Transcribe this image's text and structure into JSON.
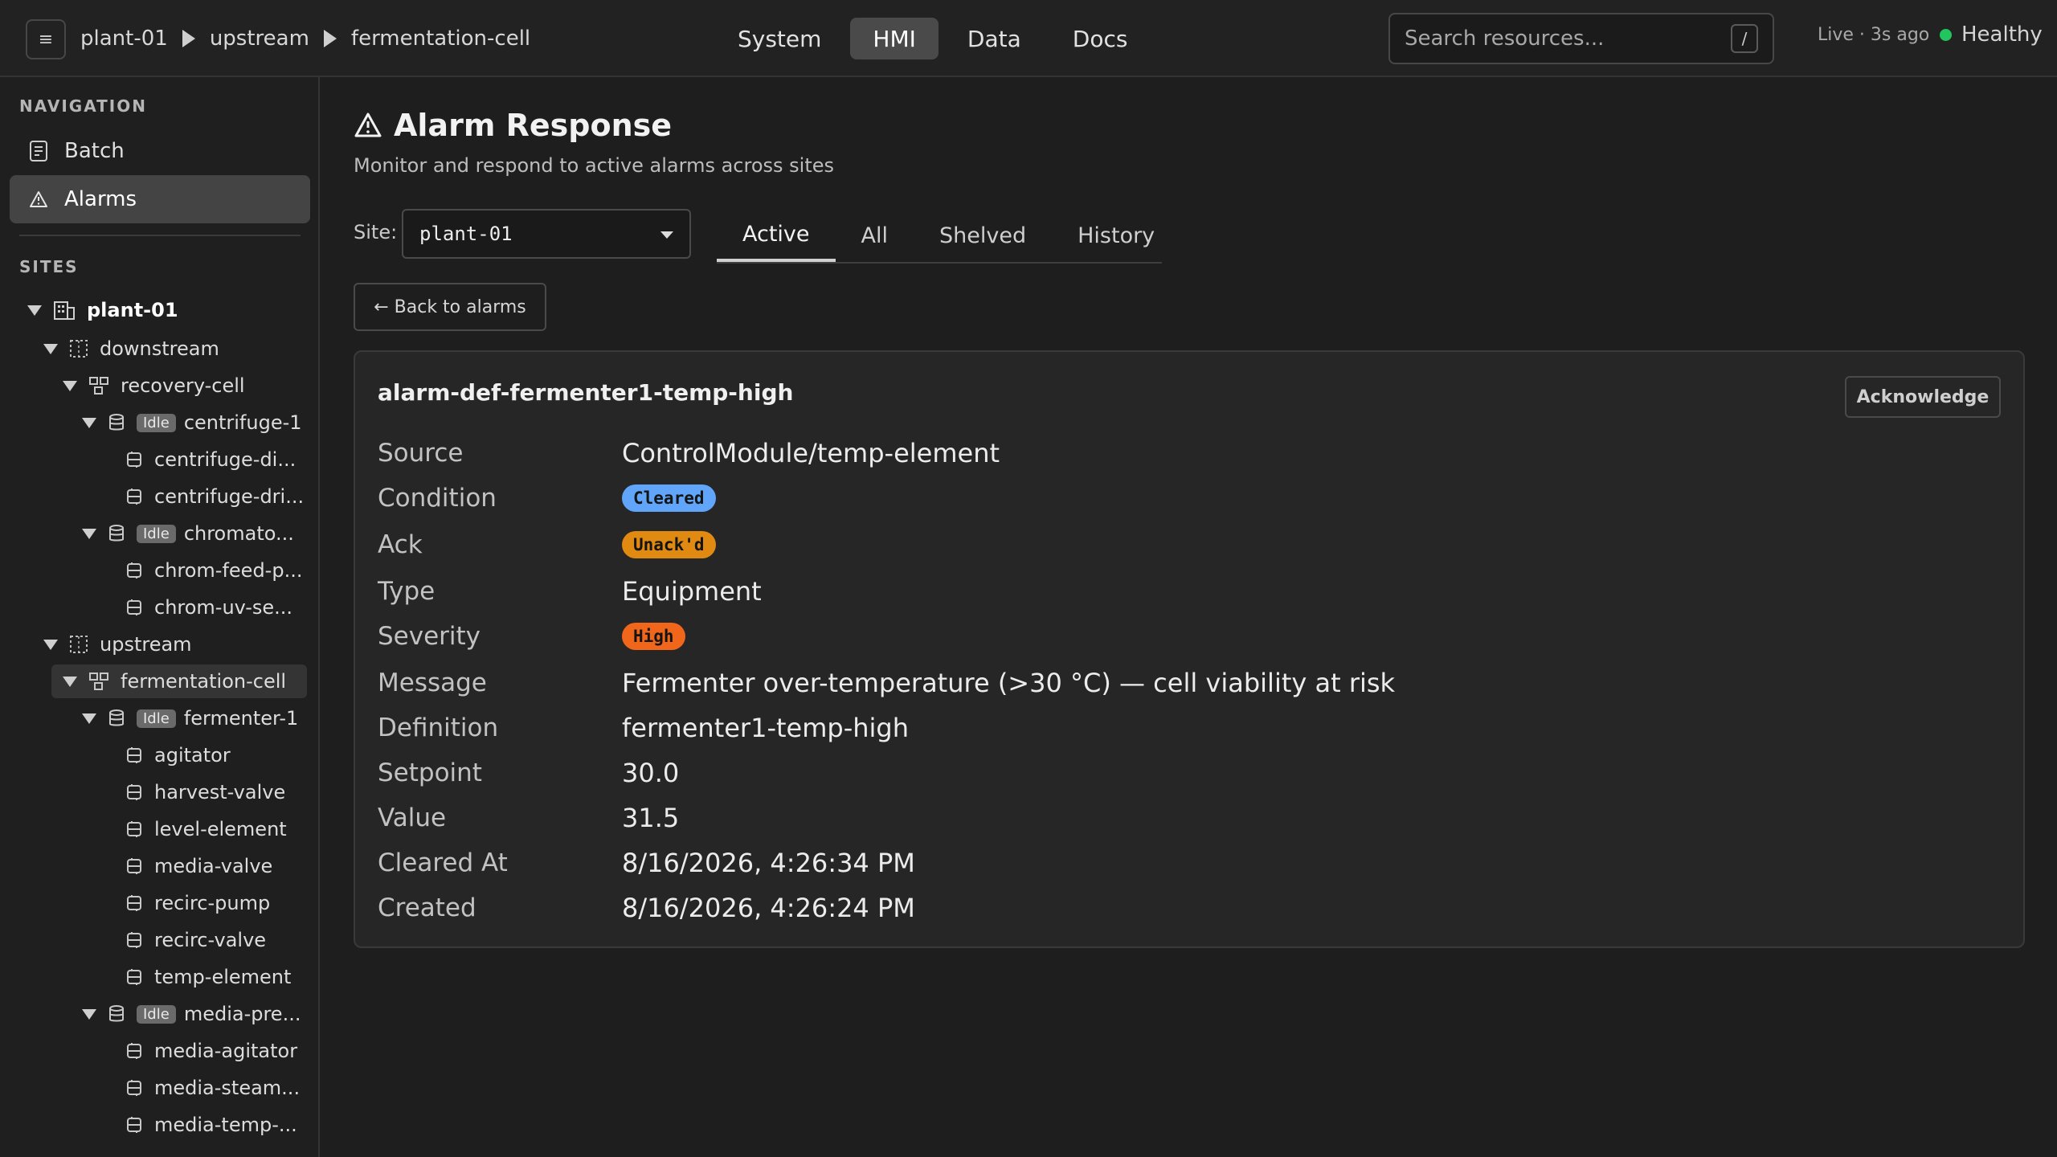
{
  "header": {
    "menu_icon": "hamburger-icon",
    "breadcrumb": [
      "plant-01",
      "upstream",
      "fermentation-cell"
    ],
    "nav": [
      "System",
      "HMI",
      "Data",
      "Docs"
    ],
    "active_nav": "HMI",
    "search": {
      "placeholder": "Search resources...",
      "shortcut": "/"
    },
    "live_status": "Live · 3s ago",
    "health": "Healthy",
    "colors": {
      "health": "#22c55e"
    }
  },
  "sidebar": {
    "navigation_label": "NAVIGATION",
    "nav_items": [
      {
        "label": "Batch",
        "icon": "document-icon"
      },
      {
        "label": "Alarms",
        "icon": "warning-icon",
        "active": true
      }
    ],
    "sites_label": "SITES",
    "tree": [
      {
        "label": "plant-01",
        "icon": "building-icon",
        "expanded": true
      },
      {
        "label": "downstream",
        "icon": "area-icon",
        "expanded": true
      },
      {
        "label": "recovery-cell",
        "icon": "cell-icon",
        "expanded": true
      },
      {
        "label": "centrifuge-1",
        "icon": "unit-icon",
        "badge": "Idle",
        "expanded": true
      },
      {
        "label": "centrifuge-di...",
        "icon": "module-icon"
      },
      {
        "label": "centrifuge-dri...",
        "icon": "module-icon"
      },
      {
        "label": "chromato...",
        "icon": "unit-icon",
        "badge": "Idle",
        "expanded": true
      },
      {
        "label": "chrom-feed-p...",
        "icon": "module-icon"
      },
      {
        "label": "chrom-uv-se...",
        "icon": "module-icon"
      },
      {
        "label": "upstream",
        "icon": "area-icon",
        "expanded": true
      },
      {
        "label": "fermentation-cell",
        "icon": "cell-icon",
        "expanded": true,
        "selected": true
      },
      {
        "label": "fermenter-1",
        "icon": "unit-icon",
        "badge": "Idle",
        "expanded": true
      },
      {
        "label": "agitator",
        "icon": "module-icon"
      },
      {
        "label": "harvest-valve",
        "icon": "module-icon"
      },
      {
        "label": "level-element",
        "icon": "module-icon"
      },
      {
        "label": "media-valve",
        "icon": "module-icon"
      },
      {
        "label": "recirc-pump",
        "icon": "module-icon"
      },
      {
        "label": "recirc-valve",
        "icon": "module-icon"
      },
      {
        "label": "temp-element",
        "icon": "module-icon"
      },
      {
        "label": "media-pre...",
        "icon": "unit-icon",
        "badge": "Idle",
        "expanded": true
      },
      {
        "label": "media-agitator",
        "icon": "module-icon"
      },
      {
        "label": "media-steam...",
        "icon": "module-icon"
      },
      {
        "label": "media-temp-...",
        "icon": "module-icon"
      }
    ]
  },
  "main": {
    "title": "Alarm Response",
    "title_icon": "warning-icon",
    "subtitle": "Monitor and respond to active alarms across sites",
    "site_label": "Site:",
    "site_value": "plant-01",
    "tabs": [
      "Active",
      "All",
      "Shelved",
      "History"
    ],
    "active_tab": "Active",
    "back_button": "← Back to alarms",
    "alarm": {
      "name": "alarm-def-fermenter1-temp-high",
      "acknowledge": "Acknowledge",
      "details": [
        {
          "key": "Source",
          "value": "ControlModule/temp-element"
        },
        {
          "key": "Condition",
          "value": "Cleared",
          "pill": true,
          "color": "#60a5fa"
        },
        {
          "key": "Ack",
          "value": "Unack'd",
          "pill": true,
          "color": "#f59e0b"
        },
        {
          "key": "Type",
          "value": "Equipment"
        },
        {
          "key": "Severity",
          "value": "High",
          "pill": true,
          "color": "#f97316"
        },
        {
          "key": "Message",
          "value": "Fermenter over-temperature (>30 °C) — cell viability at risk"
        },
        {
          "key": "Definition",
          "value": "fermenter1-temp-high"
        },
        {
          "key": "Setpoint",
          "value": "30.0"
        },
        {
          "key": "Value",
          "value": "31.5"
        },
        {
          "key": "Cleared At",
          "value": "8/16/2026, 4:26:34 PM"
        },
        {
          "key": "Created",
          "value": "8/16/2026, 4:26:24 PM"
        }
      ]
    }
  }
}
